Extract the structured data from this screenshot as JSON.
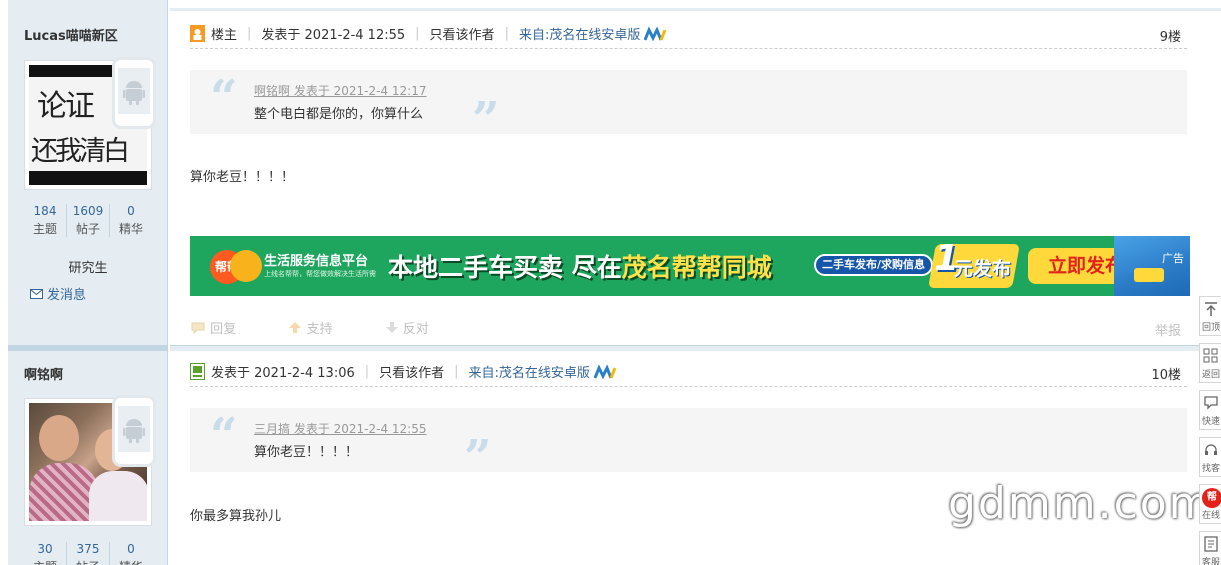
{
  "posts": [
    {
      "author": "Lucas喵喵新区",
      "author_stats": [
        {
          "value": "184",
          "label": "主题"
        },
        {
          "value": "1609",
          "label": "帖子"
        },
        {
          "value": "0",
          "label": "精华"
        }
      ],
      "rank": "研究生",
      "send_message": "发消息",
      "host_label": "楼主",
      "posted_at": "发表于 2021-2-4 12:55",
      "only_author": "只看该作者",
      "source": "来自:茂名在线安卓版",
      "floor": "9楼",
      "quote_meta": "啊铭啊 发表于 2021-2-4 12:17",
      "quote_text": "整个电白都是你的，你算什么",
      "content": "算你老豆！！！！"
    },
    {
      "author": "啊铭啊",
      "author_stats": [
        {
          "value": "30",
          "label": "主题"
        },
        {
          "value": "375",
          "label": "帖子"
        },
        {
          "value": "0",
          "label": "精华"
        }
      ],
      "posted_at": "发表于 2021-2-4 13:06",
      "only_author": "只看该作者",
      "source": "来自:茂名在线安卓版",
      "floor": "10楼",
      "quote_meta": "三月搞 发表于 2021-2-4 12:55",
      "quote_text": "算你老豆！！！！",
      "content": "你最多算我孙儿"
    }
  ],
  "avatar1_text": [
    "论证",
    "还我清白"
  ],
  "banner": {
    "logo": "帮帮",
    "platform": "生活服务信息平台",
    "platform_sub": "上线名帮帮，帮您做效解决生活所需",
    "headline_a": "本地二手车买卖 尽在",
    "headline_b": "茂名帮帮同城",
    "tag": "二手车发布/求购信息",
    "price_num": "1",
    "price_unit": "元发布",
    "cta": "立即发布",
    "ad": "广告"
  },
  "actions": {
    "reply": "回复",
    "support": "支持",
    "oppose": "反对",
    "report": "举报"
  },
  "toolbar": [
    "回顶",
    "返回",
    "快速",
    "找客",
    "在线",
    "客服"
  ],
  "toolbar_badge": "帮",
  "watermark": "gdmm.com",
  "colors": {
    "link": "#336699",
    "sidebar_bg": "#e5edf2",
    "banner_green": "#1ea55e",
    "cta_yellow": "#ffd83b"
  }
}
